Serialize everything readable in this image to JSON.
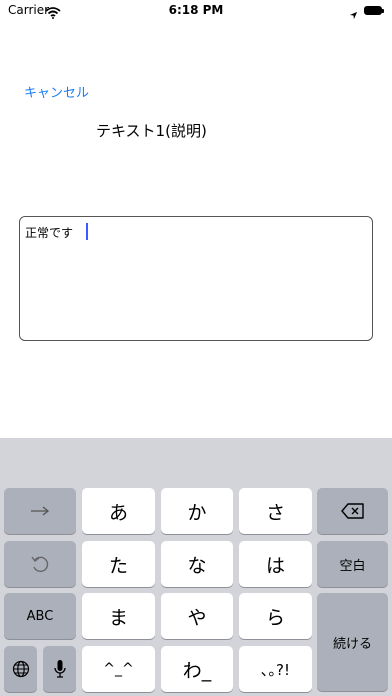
{
  "status_bar": {
    "carrier": "Carrier",
    "time": "6:18 PM"
  },
  "nav": {
    "cancel_label": "キャンセル",
    "title": "テキスト1(説明)"
  },
  "editor": {
    "value": "正常です"
  },
  "keyboard": {
    "row1": {
      "k1": "あ",
      "k2": "か",
      "k3": "さ"
    },
    "row2": {
      "k1": "た",
      "k2": "な",
      "k3": "は",
      "space": "空白"
    },
    "row3": {
      "abc": "ABC",
      "k1": "ま",
      "k2": "や",
      "k3": "ら",
      "enter": "続ける"
    },
    "row4": {
      "k1": "^_^",
      "k2": "わ_",
      "k3": "､｡?!"
    }
  }
}
